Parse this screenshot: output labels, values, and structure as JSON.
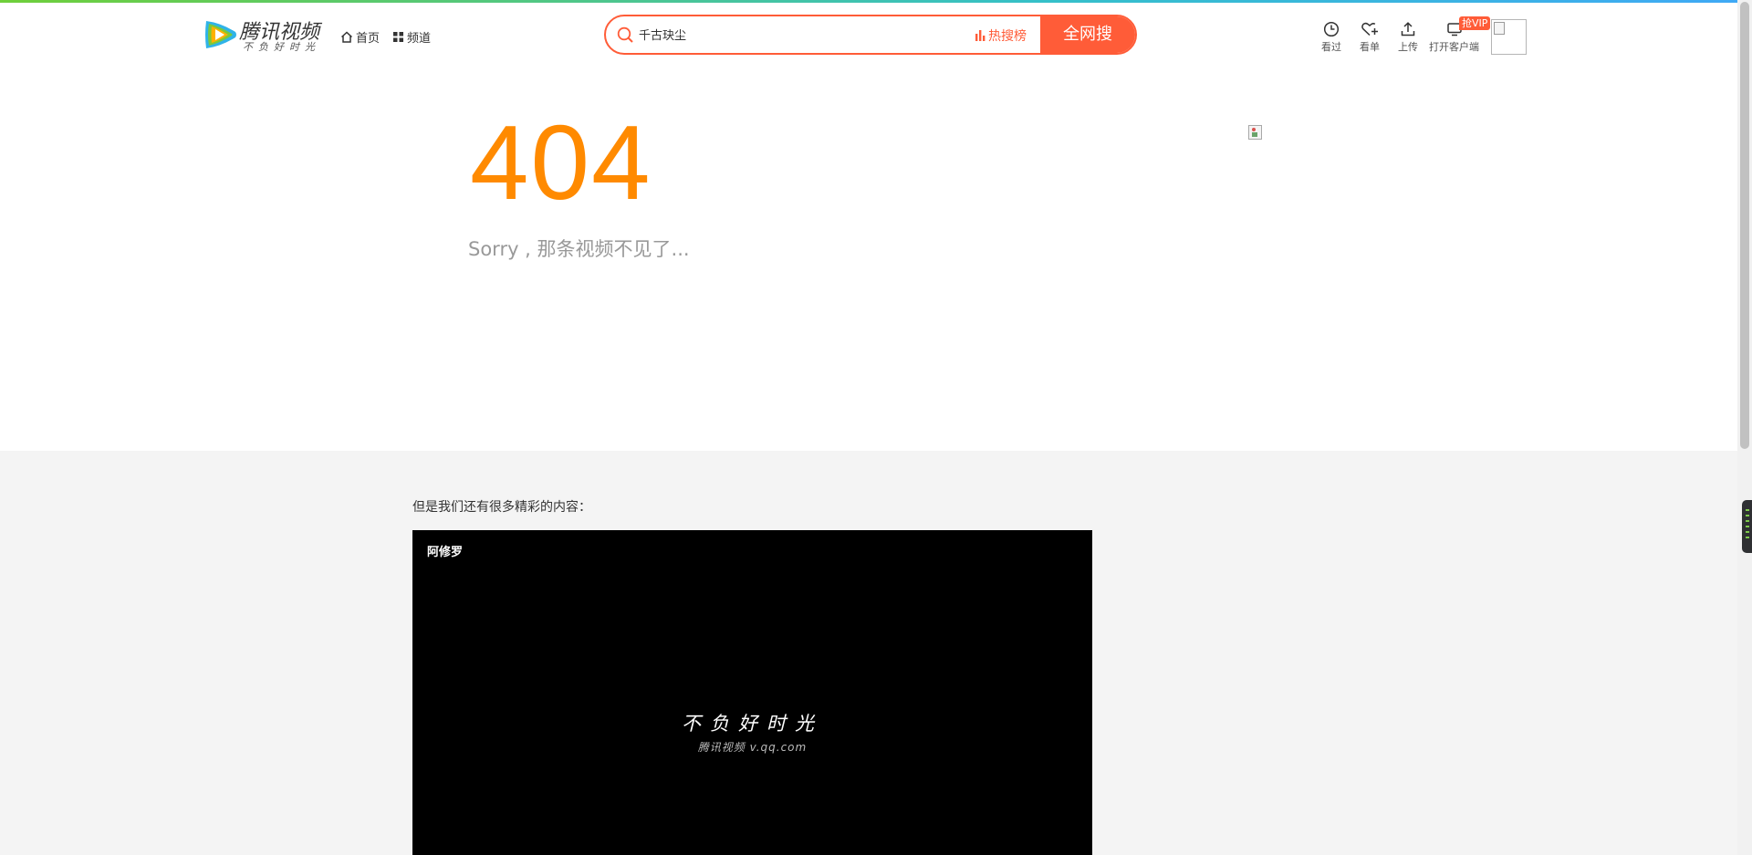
{
  "header": {
    "logo": {
      "brand": "腾讯视频",
      "slogan": "不负好时光",
      "icon": "tencent-video-play-icon"
    },
    "nav": {
      "home_label": "首页",
      "home_icon": "home-icon",
      "channel_label": "频道",
      "channel_icon": "grid-icon"
    },
    "search": {
      "placeholder": "千古玦尘",
      "hot_label": "热搜榜",
      "button_label": "全网搜",
      "icon": "search-icon"
    },
    "tools": {
      "history_label": "看过",
      "favorites_label": "看单",
      "upload_label": "上传",
      "client_label": "打开客户端",
      "vip_badge": "抢VIP"
    },
    "accent_color": "#ff5c38"
  },
  "error": {
    "code": "404",
    "message": "Sorry , 那条视频不见了...",
    "code_color": "#ff8a00"
  },
  "recommend": {
    "label": "但是我们还有很多精彩的内容：",
    "video": {
      "title": "阿修罗",
      "splash_slogan": "不负好时光",
      "splash_sub": "腾讯视频 v.qq.com"
    }
  }
}
